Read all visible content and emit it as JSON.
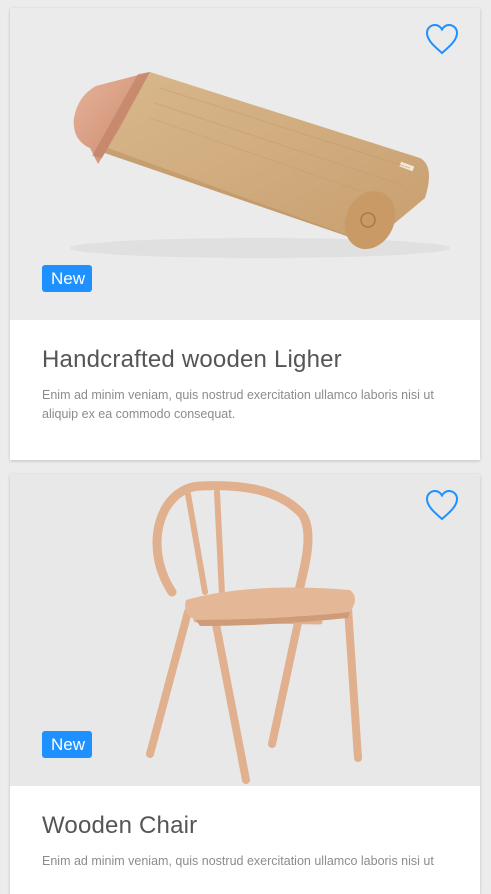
{
  "colors": {
    "accent": "#1e90ff",
    "title": "#555555",
    "desc": "#8c8c8c"
  },
  "cards": [
    {
      "title": "Handcrafted wooden Ligher",
      "description": "Enim ad minim veniam, quis nostrud exercitation ullamco laboris nisi ut aliquip ex ea commodo consequat.",
      "badge": "New",
      "favorite_icon": "heart-outline-icon",
      "image": "wooden-lighter-image"
    },
    {
      "title": "Wooden Chair",
      "description": "Enim ad minim veniam, quis nostrud exercitation ullamco laboris nisi ut",
      "badge": "New",
      "favorite_icon": "heart-outline-icon",
      "image": "wooden-chair-image"
    }
  ]
}
